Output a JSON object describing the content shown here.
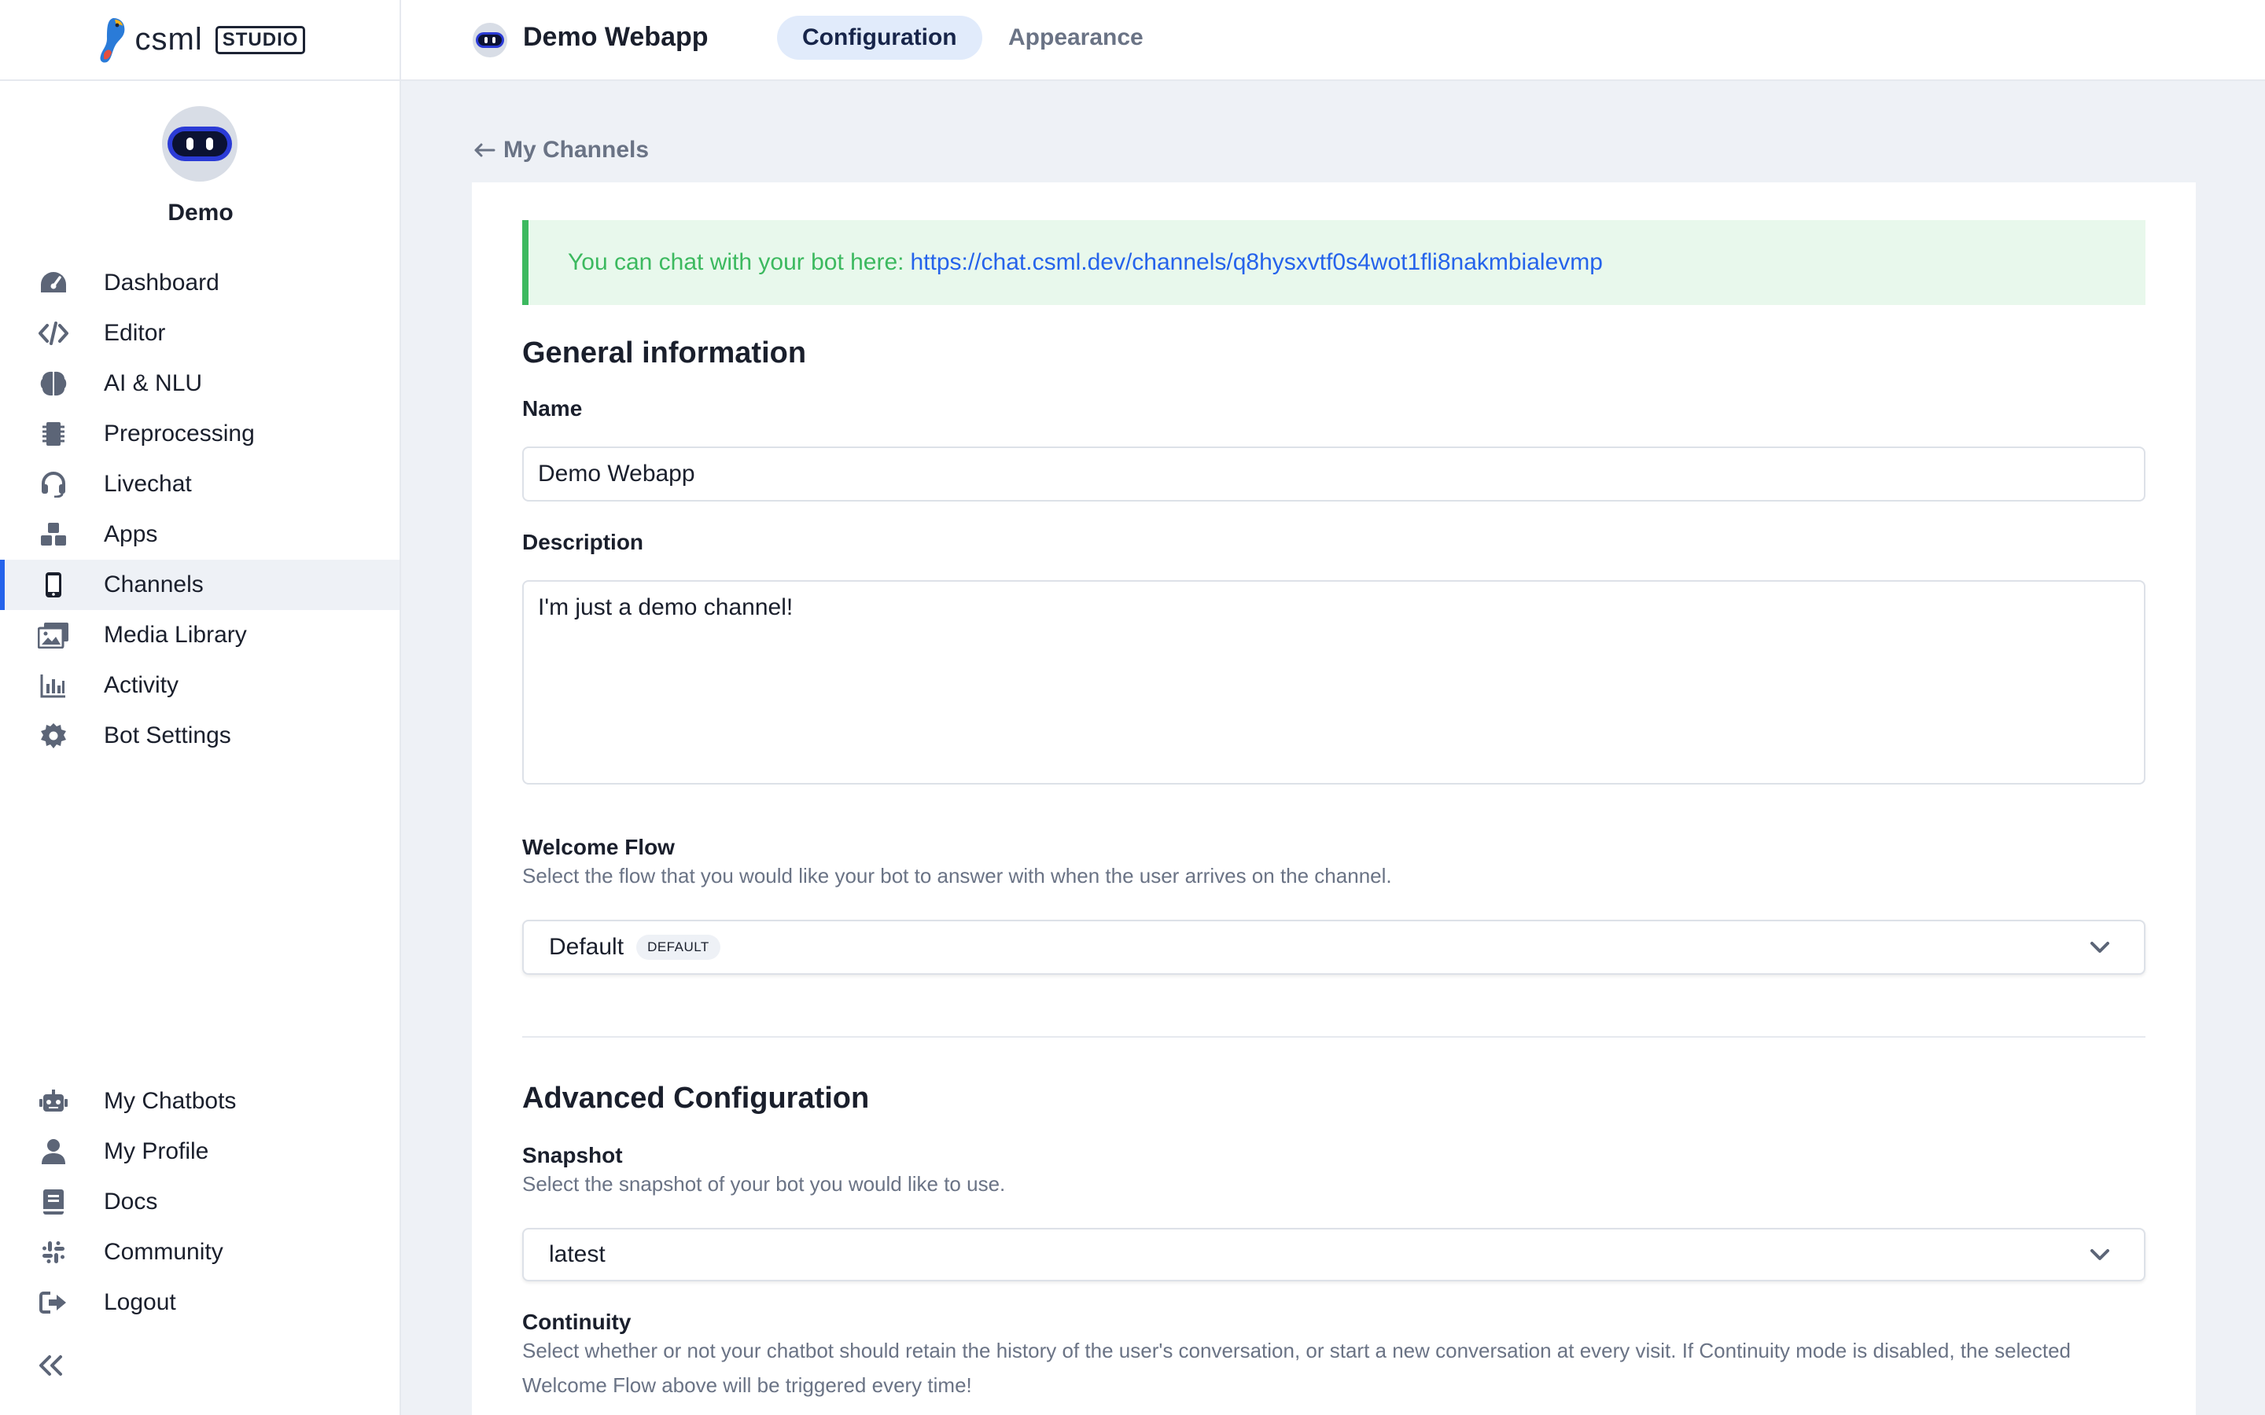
{
  "brand": {
    "word": "csml",
    "studio": "STUDIO"
  },
  "bot": {
    "name": "Demo"
  },
  "sidebar": {
    "items": [
      {
        "label": "Dashboard",
        "icon": "dashboard-gauge-icon"
      },
      {
        "label": "Editor",
        "icon": "code-icon"
      },
      {
        "label": "AI & NLU",
        "icon": "brain-icon"
      },
      {
        "label": "Preprocessing",
        "icon": "chip-icon"
      },
      {
        "label": "Livechat",
        "icon": "headset-icon"
      },
      {
        "label": "Apps",
        "icon": "cubes-icon"
      },
      {
        "label": "Channels",
        "icon": "mobile-icon",
        "active": true
      },
      {
        "label": "Media Library",
        "icon": "images-icon"
      },
      {
        "label": "Activity",
        "icon": "bar-chart-icon"
      },
      {
        "label": "Bot Settings",
        "icon": "gear-icon"
      }
    ],
    "bottom_items": [
      {
        "label": "My Chatbots",
        "icon": "robot-icon"
      },
      {
        "label": "My Profile",
        "icon": "user-icon"
      },
      {
        "label": "Docs",
        "icon": "book-icon"
      },
      {
        "label": "Community",
        "icon": "slack-icon"
      },
      {
        "label": "Logout",
        "icon": "logout-icon"
      }
    ],
    "collapse_icon": "double-chevron-left-icon"
  },
  "header": {
    "channel_title": "Demo Webapp",
    "tabs": [
      {
        "label": "Configuration",
        "active": true
      },
      {
        "label": "Appearance",
        "active": false
      }
    ]
  },
  "back_link": "My Channels",
  "notice": {
    "text": "You can chat with your bot here:",
    "link": "https://chat.csml.dev/channels/q8hysxvtf0s4wot1fli8nakmbialevmp"
  },
  "general": {
    "heading": "General information",
    "name_label": "Name",
    "name_value": "Demo Webapp",
    "description_label": "Description",
    "description_value": "I'm just a demo channel!",
    "welcome_label": "Welcome Flow",
    "welcome_help": "Select the flow that you would like your bot to answer with when the user arrives on the channel.",
    "welcome_value": "Default",
    "welcome_badge": "DEFAULT"
  },
  "advanced": {
    "heading": "Advanced Configuration",
    "snapshot_label": "Snapshot",
    "snapshot_help": "Select the snapshot of your bot you would like to use.",
    "snapshot_value": "latest",
    "continuity_label": "Continuity",
    "continuity_help": "Select whether or not your chatbot should retain the history of the user's conversation, or start a new conversation at every visit. If Continuity mode is disabled, the selected Welcome Flow above will be triggered every time!"
  },
  "colors": {
    "accent": "#2563eb",
    "success": "#3cb95f",
    "tab_active_bg": "#e1ebfb"
  }
}
